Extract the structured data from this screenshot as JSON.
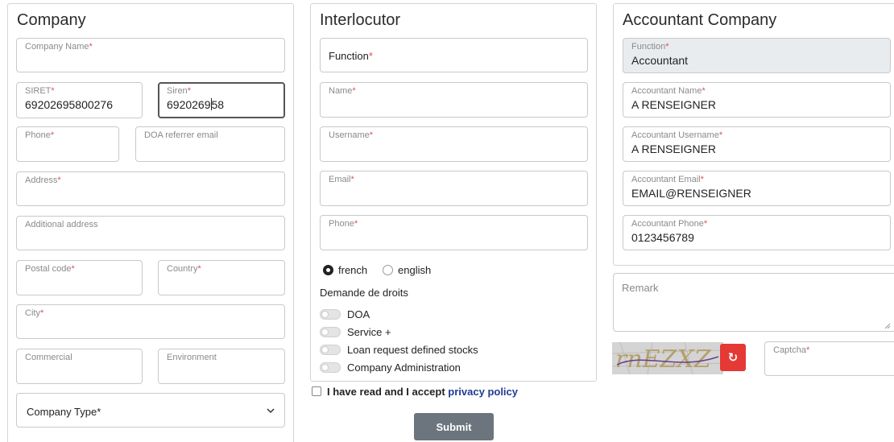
{
  "company": {
    "title": "Company",
    "company_name_label": "Company Name",
    "siret_label": "SIRET",
    "siret_value": "69202695800276",
    "siren_label": "Siren",
    "siren_value_a": "6920269",
    "siren_value_b": "58",
    "phone_label": "Phone",
    "doa_email_label": "DOA referrer email",
    "address_label": "Address",
    "additional_address_label": "Additional address",
    "postal_code_label": "Postal code",
    "country_label": "Country",
    "city_label": "City",
    "commercial_label": "Commercial",
    "environment_label": "Environment",
    "company_type_label": "Company Type*"
  },
  "interlocutor": {
    "title": "Interlocutor",
    "function_label": "Function",
    "name_label": "Name",
    "username_label": "Username",
    "email_label": "Email",
    "phone_label": "Phone",
    "lang_french": "french",
    "lang_english": "english",
    "rights_heading": "Demande de droits",
    "rights": [
      "DOA",
      "Service +",
      "Loan request defined stocks",
      "Company Administration"
    ]
  },
  "accountant": {
    "title": "Accountant Company",
    "function_label": "Function",
    "function_value": "Accountant",
    "name_label": "Accountant Name",
    "name_value": "A RENSEIGNER",
    "username_label": "Accountant Username",
    "username_value": "A RENSEIGNER",
    "email_label": "Accountant Email",
    "email_value": "EMAIL@RENSEIGNER",
    "phone_label": "Accountant Phone",
    "phone_value": "0123456789"
  },
  "remark": {
    "placeholder": "Remark"
  },
  "captcha": {
    "label": "Captcha",
    "image_text": "rnEZXZ",
    "refresh_glyph": "↻"
  },
  "consent": {
    "text": "I have read and I accept ",
    "link": "privacy policy"
  },
  "submit_label": "Submit",
  "required_mark": "*",
  "colors": {
    "required": "#d9534f",
    "link": "#1f3a93",
    "submit_bg": "#6c757d",
    "refresh_bg": "#e53935",
    "disabled_bg": "#e9ecef"
  }
}
